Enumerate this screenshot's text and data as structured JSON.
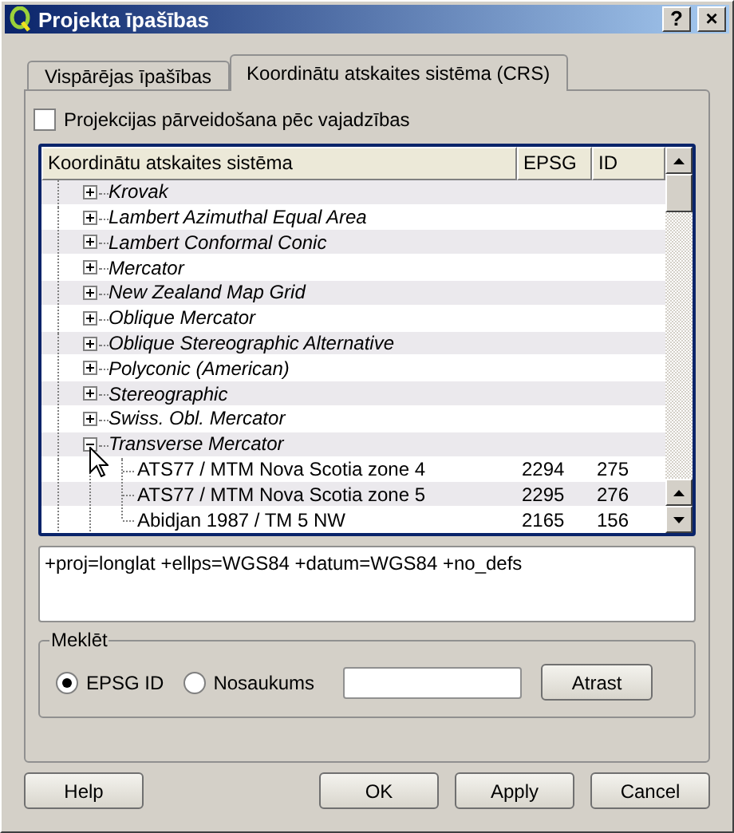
{
  "window": {
    "title": "Projekta īpašības",
    "help_button": "?",
    "close_button": "×"
  },
  "tabs": [
    {
      "label": "Vispārējas īpašības",
      "selected": false
    },
    {
      "label": "Koordinātu atskaites sistēma (CRS)",
      "selected": true
    }
  ],
  "on_the_fly": {
    "label": "Projekcijas pārveidošana pēc vajadzības",
    "checked": false
  },
  "crs_tree": {
    "columns": [
      "Koordinātu atskaites sistēma",
      "EPSG",
      "ID"
    ],
    "items": [
      {
        "name": "Krovak",
        "expanded": false
      },
      {
        "name": "Lambert Azimuthal Equal Area",
        "expanded": false
      },
      {
        "name": "Lambert Conformal Conic",
        "expanded": false
      },
      {
        "name": "Mercator",
        "expanded": false
      },
      {
        "name": "New Zealand Map Grid",
        "expanded": false
      },
      {
        "name": "Oblique Mercator",
        "expanded": false
      },
      {
        "name": "Oblique Stereographic Alternative",
        "expanded": false
      },
      {
        "name": "Polyconic (American)",
        "expanded": false
      },
      {
        "name": "Stereographic",
        "expanded": false
      },
      {
        "name": "Swiss. Obl. Mercator",
        "expanded": false
      },
      {
        "name": "Transverse Mercator",
        "expanded": true,
        "children": [
          {
            "name": "ATS77 / MTM Nova Scotia zone 4",
            "epsg": "2294",
            "id": "275"
          },
          {
            "name": "ATS77 / MTM Nova Scotia zone 5",
            "epsg": "2295",
            "id": "276"
          },
          {
            "name": "Abidjan 1987 / TM 5 NW",
            "epsg": "2165",
            "id": "156"
          }
        ]
      }
    ]
  },
  "proj_string": "+proj=longlat +ellps=WGS84 +datum=WGS84 +no_defs",
  "search": {
    "title": "Meklēt",
    "options": [
      {
        "label": "EPSG ID",
        "selected": true
      },
      {
        "label": "Nosaukums",
        "selected": false
      }
    ],
    "button": "Atrast"
  },
  "buttons": [
    "Help",
    "OK",
    "Apply",
    "Cancel"
  ]
}
